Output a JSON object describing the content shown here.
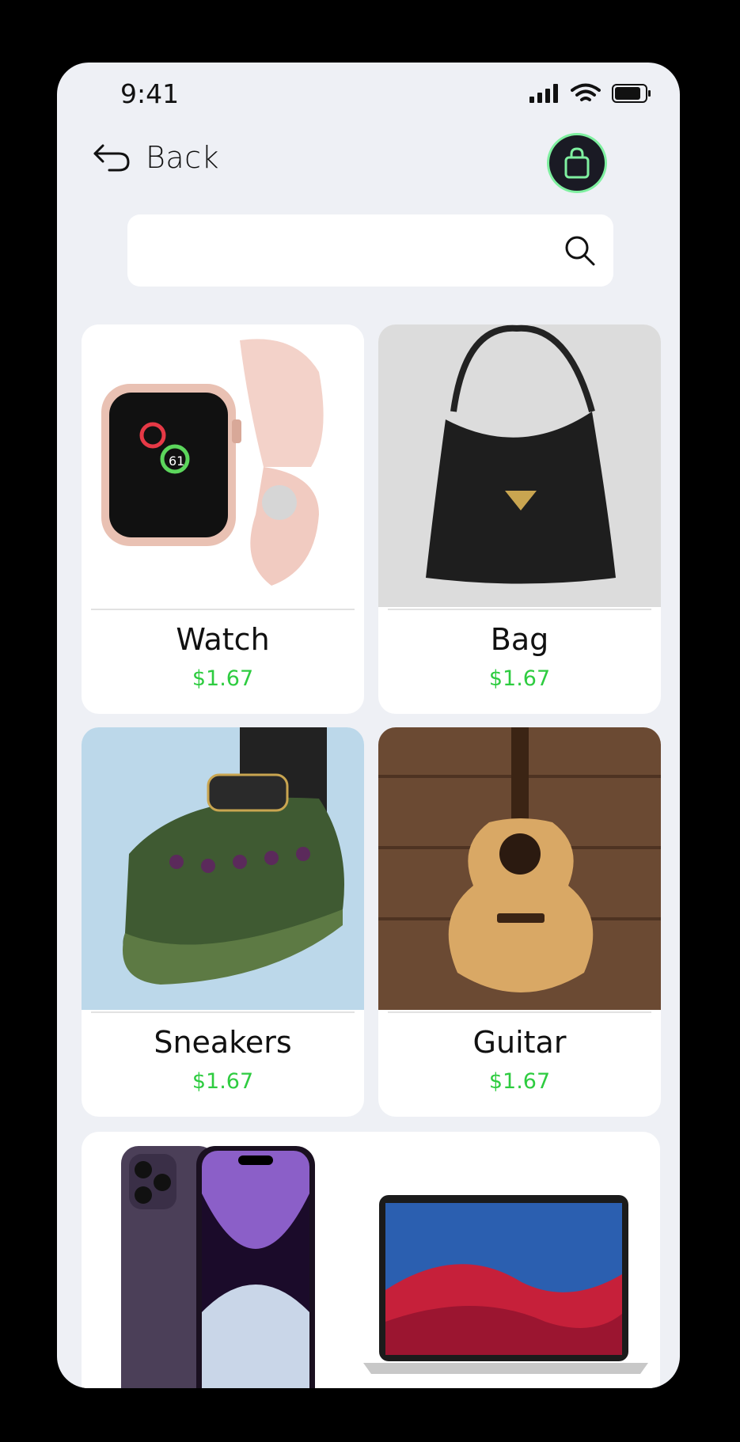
{
  "status": {
    "time": "9:41"
  },
  "header": {
    "back_label": "Back"
  },
  "search": {
    "placeholder": ""
  },
  "products": [
    {
      "name": "Watch",
      "price": "$1.67",
      "image": "watch"
    },
    {
      "name": "Bag",
      "price": "$1.67",
      "image": "bag"
    },
    {
      "name": "Sneakers",
      "price": "$1.67",
      "image": "sneakers"
    },
    {
      "name": "Guitar",
      "price": "$1.67",
      "image": "guitar"
    }
  ],
  "partial_row": {
    "images": [
      "iphone",
      "macbook"
    ]
  },
  "colors": {
    "accent": "#7ff0a0",
    "price": "#2ecc40",
    "background": "#eef0f5"
  }
}
